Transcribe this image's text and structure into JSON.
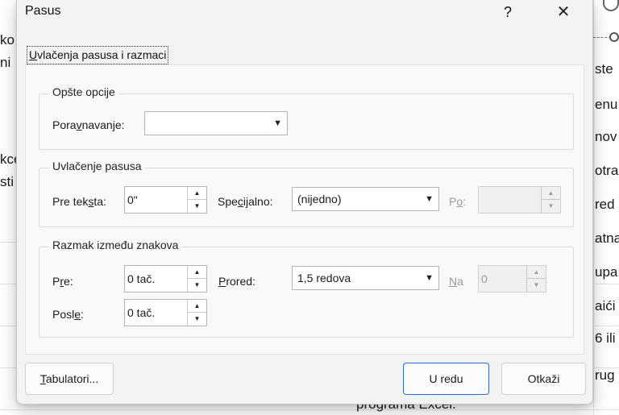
{
  "dialog": {
    "title": "Pasus",
    "help_label": "?",
    "close_label": "✕",
    "tab_label": "Uvlačenja pasusa i razmaci",
    "general": {
      "legend": "Opšte opcije",
      "alignment_label_pre": "Pora",
      "alignment_label_key": "v",
      "alignment_label_post": "navanje:",
      "alignment_value": ""
    },
    "indent": {
      "legend": "Uvlačenje pasusa",
      "before_text_label_pre": "Pre tek",
      "before_text_label_key": "s",
      "before_text_label_post": "ta:",
      "before_text_value": "0\"",
      "special_label_pre": "Spe",
      "special_label_key": "c",
      "special_label_post": "ijalno:",
      "special_value": "(nijedno)",
      "by_label_pre": "P",
      "by_label_key": "o",
      "by_label_post": ":",
      "by_value": ""
    },
    "spacing": {
      "legend": "Razmak između znakova",
      "before_label_pre": "P",
      "before_label_key": "r",
      "before_label_post": "e:",
      "before_value": "0 tač.",
      "line_spacing_label_key": "P",
      "line_spacing_label_post": "rored:",
      "line_spacing_value": "1,5 redova",
      "at_label_key": "N",
      "at_label_post": "a",
      "at_value": "0",
      "after_label_pre": "Posl",
      "after_label_key": "e",
      "after_label_post": ":",
      "after_value": "0 tač."
    },
    "buttons": {
      "tabs_key": "T",
      "tabs_post": "abulatori...",
      "ok": "U redu",
      "cancel": "Otkaži"
    }
  },
  "background": {
    "left_fragments": [
      "ko",
      "ni",
      "kce",
      "sti"
    ],
    "right_fragments": [
      "ste",
      "enu",
      "nov",
      "otra",
      "red",
      "atna",
      "upa",
      "aići",
      "6 ili",
      "rug"
    ],
    "footer_text": "programa Excel."
  },
  "colors": {
    "dialog_bg": "#f3f3f3",
    "panel_bg": "#f9f9f9",
    "primary_border": "#2b6cd4"
  },
  "icons": {
    "dropdown": "chevron-down-icon",
    "spin_up": "caret-up-icon",
    "spin_down": "caret-down-icon"
  }
}
